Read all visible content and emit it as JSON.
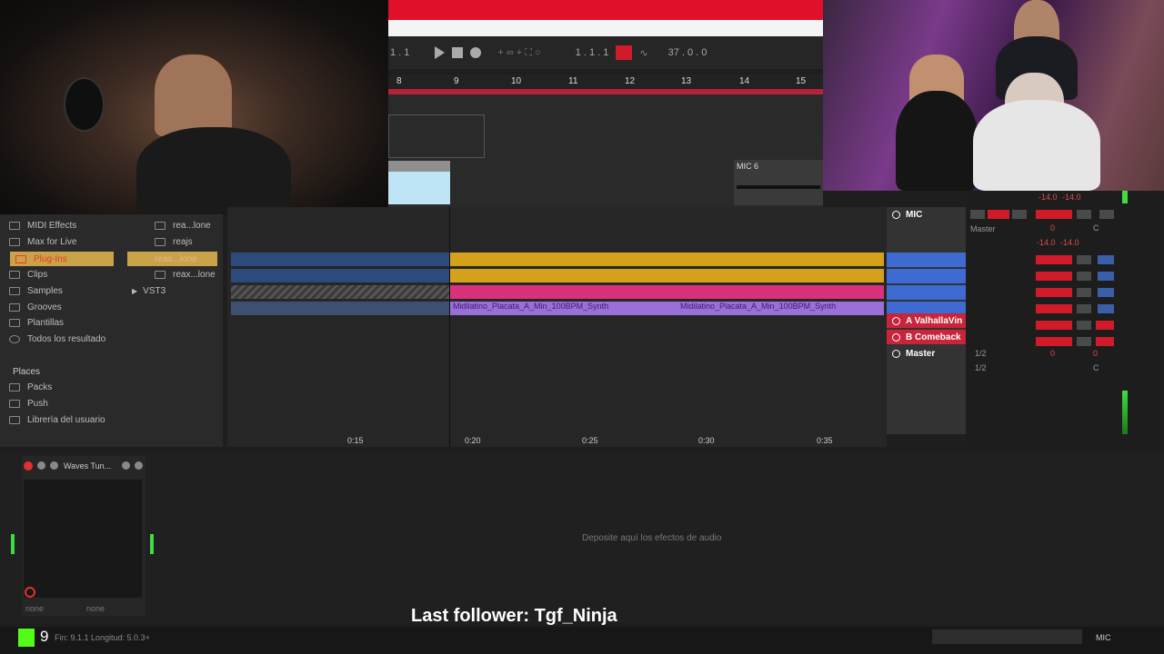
{
  "transport": {
    "position": "1 . 1",
    "bar_beat": "1 . 1 . 1",
    "tempo_display": "37 . 0 . 0"
  },
  "ruler": {
    "bars": [
      "8",
      "9",
      "10",
      "11",
      "12",
      "13",
      "14",
      "15"
    ]
  },
  "timeline": {
    "ticks": [
      "0:15",
      "0:20",
      "0:25",
      "0:30",
      "0:35"
    ]
  },
  "clips": {
    "midi_clip_name": "Midilatino_Placata_A_Min_100BPM_Synth",
    "midi_clip_name_2": "Midilatino_Placata_A_Min_100BPM_Synth",
    "mic6_label": "MIC 6"
  },
  "browser": {
    "items": [
      {
        "label": "MIDI Effects"
      },
      {
        "label": "Max for Live"
      },
      {
        "label": "Plug-Ins"
      },
      {
        "label": "Clips"
      },
      {
        "label": "Samples"
      },
      {
        "label": "Grooves"
      },
      {
        "label": "Plantillas"
      },
      {
        "label": "Todos los resultado"
      }
    ],
    "plugins": [
      {
        "label": "rea...lone"
      },
      {
        "label": "reajs"
      },
      {
        "label": "reas...lone"
      },
      {
        "label": "reax...lone"
      },
      {
        "label": "VST3"
      }
    ],
    "places_header": "Places",
    "places": [
      {
        "label": "Packs"
      },
      {
        "label": "Push"
      },
      {
        "label": "Librería del usuario"
      }
    ]
  },
  "tracks": {
    "mic": "MIC",
    "return_a": "A ValhallaVin",
    "return_b": "B Comeback",
    "master": "Master"
  },
  "mixer": {
    "vol_a": "-14.0",
    "vol_b": "-14.0",
    "vol_c": "-14.0",
    "vol_d": "-14.0",
    "zero_1": "0",
    "zero_2": "0",
    "zero_3": "0",
    "center": "C",
    "center_2": "C",
    "io_1": "1/2",
    "io_2": "1/2",
    "master_label": "Master"
  },
  "device": {
    "title": "Waves Tun...",
    "none_left": "none",
    "none_right": "none",
    "drop_hint": "Deposite aquí los efectos de audio"
  },
  "status": {
    "loop_info": "Fin: 9.1.1  Longitud: 5.0.3+",
    "follower": "Last follower: Tgf_Ninja",
    "kick_count": "9",
    "track_name": "MIC"
  },
  "colors": {
    "banner": "#e0102a",
    "midi_clip": "#9b6fd8",
    "audio_clip": "#d4a21a",
    "pink_clip": "#d9327a",
    "blue_clip": "#2c4a7a",
    "mixer_red": "#d11b2a",
    "kick_green": "#53fc18"
  }
}
